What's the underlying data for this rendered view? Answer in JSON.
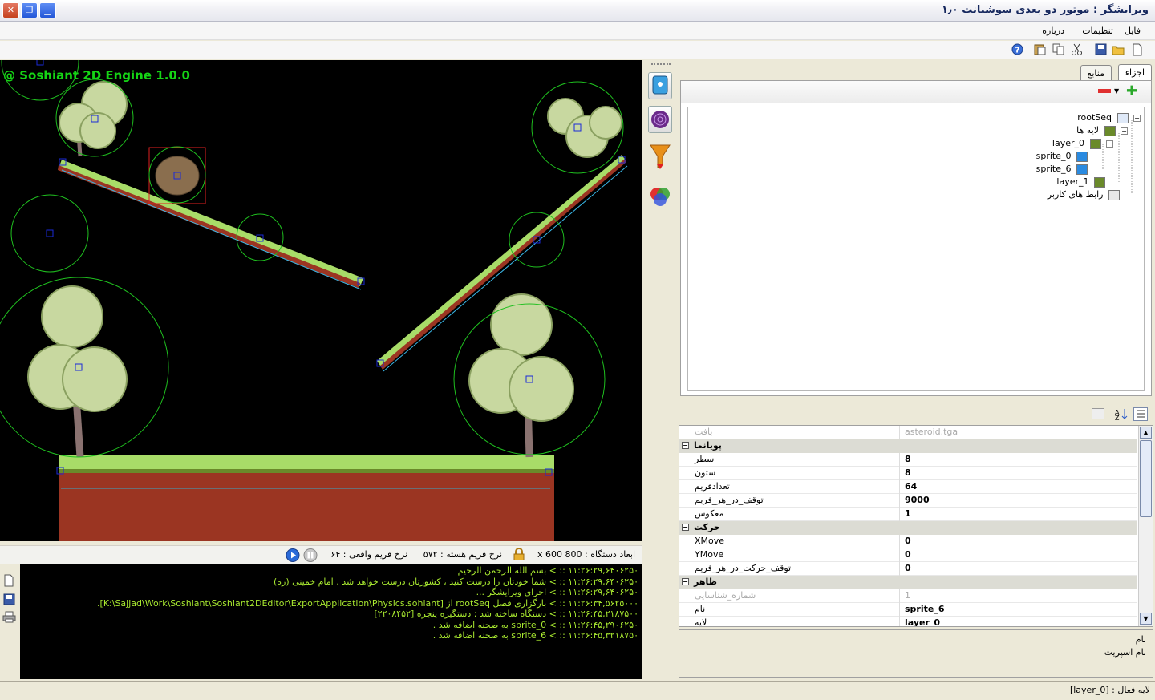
{
  "window": {
    "title": "ویرایشگر : موتور دو بعدی سوشیانت ۱٫۰",
    "close_symbol": "✕",
    "restore_symbol": "❐",
    "minimize_symbol": "▁"
  },
  "menu": [
    "فایل",
    "تنظیمات",
    "درباره"
  ],
  "engine_title": "@ Soshiant 2D Engine 1.0.0",
  "tabs": [
    "اجزاء",
    "منابع"
  ],
  "tree": {
    "root": "rootSeq",
    "layers_label": "لایه ها",
    "layer_0": "layer_0",
    "sprite_0": "sprite_0",
    "sprite_6": "sprite_6",
    "layer_1": "layer_1",
    "ui": "رابط های کاربر"
  },
  "properties": {
    "texture_label": "بافت",
    "texture_value": "asteroid.tga",
    "cat_animation": "پویانما",
    "rows_label": "سطر",
    "rows_value": "8",
    "cols_label": "ستون",
    "cols_value": "8",
    "frames_label": "تعدادفریم",
    "frames_value": "64",
    "delay_label": "توقف_در_هر_فریم",
    "delay_value": "9000",
    "reverse_label": "معکوس",
    "reverse_value": "1",
    "cat_motion": "حرکت",
    "xmove_label": "XMove",
    "xmove_value": "0",
    "ymove_label": "YMove",
    "ymove_value": "0",
    "move_delay_label": "توقف_حرکت_در_هر_فریم",
    "move_delay_value": "0",
    "cat_appearance": "ظاهر",
    "id_label": "شماره_شناسایی",
    "id_value": "1",
    "name_label": "نام",
    "name_value": "sprite_6",
    "layer_label": "لایه",
    "layer_value": "layer_0"
  },
  "help": {
    "title": "نام",
    "desc": "نام اسپریت"
  },
  "status": {
    "device_size_label": "ابعاد دستگاه :",
    "device_size_value": "800 x 600",
    "core_fps_label": "نرخ فریم هسته :",
    "core_fps_value": "۵۷۲",
    "real_fps_label": "نرخ فریم واقعی :",
    "real_fps_value": "۶۴"
  },
  "console": [
    "۱۱:۲۶:۲۹,۶۴۰۶۲۵۰ :: > بسم الله الرحمن الرحیم",
    "۱۱:۲۶:۲۹,۶۴۰۶۲۵۰ :: > شما خودتان را درست کنید ، کشورتان درست خواهد شد . امام خمینی (ره)",
    "۱۱:۲۶:۲۹,۶۴۰۶۲۵۰ :: > اجرای ویرایشگر ...",
    "۱۱:۲۶:۳۴,۵۶۲۵۰۰۰ :: > بارگزاری فصل rootSeq از [K:\\Sajjad\\Work\\Soshiant\\Soshiant2DEditor\\ExportApplication\\Physics.sohiant].",
    "۱۱:۲۶:۴۵,۲۱۸۷۵۰۰ :: > دستگاه ساخته شد : دستگیره پنجره [۲۲۰۸۴۵۲]",
    "۱۱:۲۶:۴۵,۲۹۰۶۲۵۰ :: > sprite_0  به صحنه اضافه شد .",
    "۱۱:۲۶:۴۵,۳۲۱۸۷۵۰ :: > sprite_6  به صحنه اضافه شد ."
  ],
  "active_layer": {
    "label": "لایه فعال :",
    "value": "[layer_0]"
  },
  "colors": {
    "viewport_bg": "#000000",
    "engine_title": "#15d515",
    "console_text": "#a8e830",
    "bound_circle": "#1fbf1f"
  }
}
